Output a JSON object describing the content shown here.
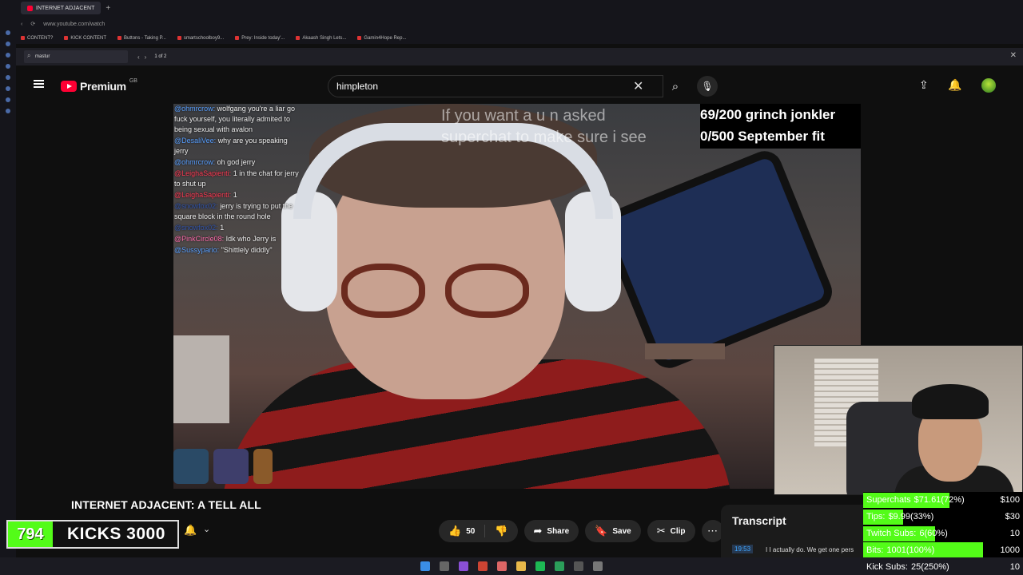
{
  "browser": {
    "tab_title": "INTERNET ADJACENT",
    "url": "www.youtube.com/watch",
    "bookmarks": [
      "CONTENT?",
      "KICK CONTENT",
      "Buttons - Taking P...",
      "smartschoolboy9...",
      "Prey: Inside today'...",
      "Akaash Singh Lets...",
      "Gamin4Hope Rep..."
    ],
    "find": {
      "query": "mastur",
      "count": "1 of 2"
    }
  },
  "youtube": {
    "logo": "Premium",
    "region": "GB",
    "search_value": "himpleton"
  },
  "video": {
    "title": "INTERNET ADJACENT: A TELL ALL",
    "caption": [
      "If you want a    u   n asked",
      "superchat to make sure i see"
    ],
    "goal_lines": [
      "69/200 grinch jonkler",
      "0/500 September fit"
    ],
    "chat": [
      {
        "user": "",
        "msg": "",
        "cls": ""
      },
      {
        "user": "@ohmrcrow:",
        "msg": "wolfgang you're a liar go fuck yourself, you literally admited to being sexual with avalon",
        "cls": ""
      },
      {
        "user": "@DesaliVee:",
        "msg": "why are you speaking jerry",
        "cls": ""
      },
      {
        "user": "@ohmrcrow:",
        "msg": "oh god jerry",
        "cls": ""
      },
      {
        "user": "@LeighaSapienti:",
        "msg": "1 in the chat for jerry to shut up",
        "cls": "red"
      },
      {
        "user": "@LeighaSapienti:",
        "msg": "1",
        "cls": "red"
      },
      {
        "user": "@snowfox02:",
        "msg": "jerry is trying to put the square block in the round hole",
        "cls": "dim"
      },
      {
        "user": "@snowfox02:",
        "msg": "1",
        "cls": "dim"
      },
      {
        "user": "@PinkCircle08:",
        "msg": "Idk who Jerry is",
        "cls": "pink"
      },
      {
        "user": "@Sussypario:",
        "msg": "\"Shittlely diddly\"",
        "cls": ""
      }
    ]
  },
  "channel": {
    "kicks_count": "794",
    "kicks_label": "KICKS 3000"
  },
  "actions": {
    "likes": "50",
    "share": "Share",
    "save": "Save",
    "clip": "Clip"
  },
  "transcript": {
    "heading": "Transcript",
    "timestamp": "19:53",
    "segment": "I I actually do. We get one pers"
  },
  "stats": [
    {
      "label": "Superchats",
      "value": "$71.61(72%)",
      "goal": "$100",
      "fill": 0.72
    },
    {
      "label": "Tips:",
      "value": "$9.99(33%)",
      "goal": "$30",
      "fill": 0.33
    },
    {
      "label": "Twitch Subs:",
      "value": "6(60%)",
      "goal": "10",
      "fill": 0.6
    },
    {
      "label": "Bits:",
      "value": "1001(100%)",
      "goal": "1000",
      "fill": 1.0
    },
    {
      "label": "Kick Subs:",
      "value": "25(250%)",
      "goal": "10",
      "fill": 1.0
    }
  ],
  "colors": {
    "youtube_red": "#ff0033",
    "kick_green": "#53fc18"
  }
}
